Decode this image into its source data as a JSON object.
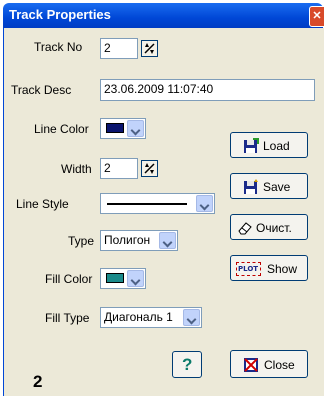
{
  "window": {
    "title": "Track Properties"
  },
  "fields": {
    "track_no": {
      "label": "Track No",
      "value": "2"
    },
    "track_desc": {
      "label": "Track Desc",
      "value": "23.06.2009 11:07:40"
    },
    "line_color": {
      "label": "Line Color",
      "color": "#0a146e"
    },
    "width": {
      "label": "Width",
      "value": "2"
    },
    "line_style": {
      "label": "Line Style"
    },
    "type": {
      "label": "Type",
      "value": "Полигон"
    },
    "fill_color": {
      "label": "Fill Color",
      "color": "#1a8a8a"
    },
    "fill_type": {
      "label": "Fill Type",
      "value": "Диагональ 1"
    }
  },
  "buttons": {
    "load": "Load",
    "save": "Save",
    "clear": "Очист.",
    "show": "Show",
    "show_icon_text": "PLOT",
    "help": "?",
    "close": "Close"
  },
  "number_label": "2"
}
